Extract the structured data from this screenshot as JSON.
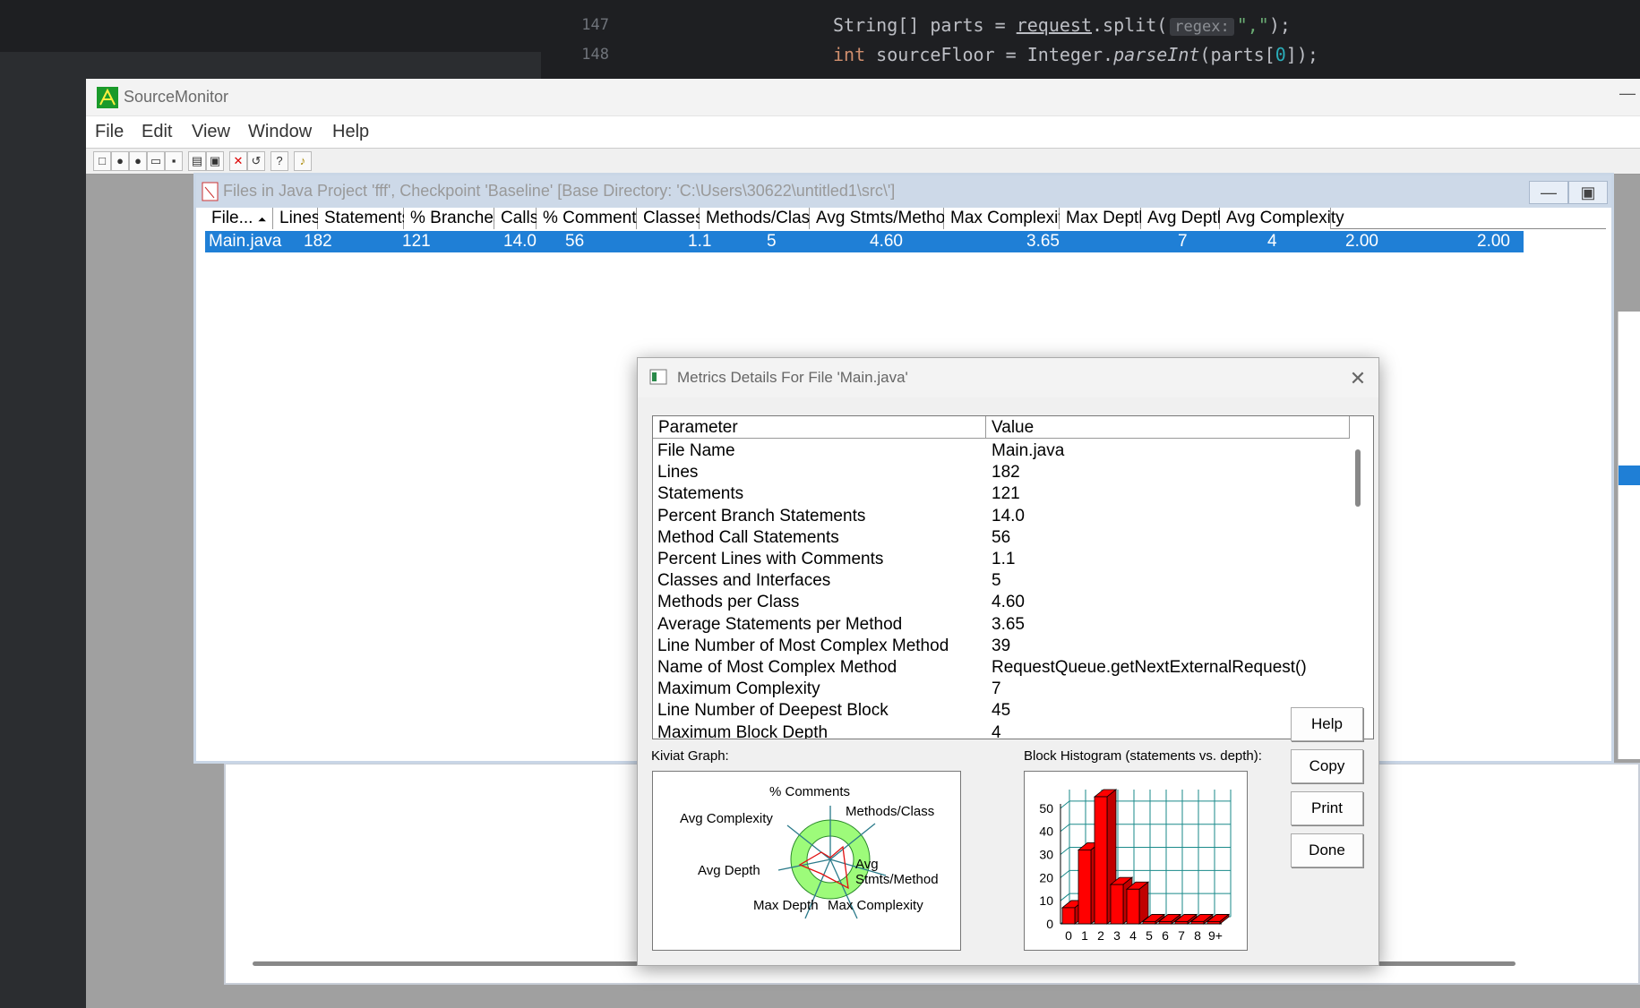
{
  "ide": {
    "line_numbers": [
      "147",
      "148"
    ],
    "line1": {
      "type": "String[] parts = ",
      "call": "request",
      "split": ".split(",
      "hint": "regex:",
      "str": "\",\"",
      "end": ");"
    },
    "line2": {
      "kw": "int",
      "rest": " sourceFloor = Integer.",
      "method": "parseInt",
      "args_open": "(parts[",
      "idx": "0",
      "args_close": "]);"
    }
  },
  "app": {
    "title": "SourceMonitor",
    "menu": [
      "File",
      "Edit",
      "View",
      "Window",
      "Help"
    ]
  },
  "files_window": {
    "title": "Files in Java Project 'fff', Checkpoint 'Baseline'  [Base Directory: 'C:\\Users\\30622\\untitled1\\src\\']",
    "columns": [
      "File...",
      "Lines",
      "Statements",
      "% Branches",
      "Calls",
      "% Comments",
      "Classes",
      "Methods/Class",
      "Avg Stmts/Method",
      "Max Complexity",
      "Max Depth",
      "Avg Depth",
      "Avg Complexity"
    ],
    "row": [
      "Main.java",
      "182",
      "121",
      "14.0",
      "56",
      "1.1",
      "5",
      "4.60",
      "3.65",
      "7",
      "4",
      "2.00",
      "2.00"
    ]
  },
  "dialog": {
    "title": "Metrics Details For File 'Main.java'",
    "header_param": "Parameter",
    "header_value": "Value",
    "rows": [
      {
        "p": "File Name",
        "v": "Main.java"
      },
      {
        "p": "Lines",
        "v": "182"
      },
      {
        "p": "Statements",
        "v": "121"
      },
      {
        "p": "Percent Branch Statements",
        "v": "14.0"
      },
      {
        "p": "Method Call Statements",
        "v": "56"
      },
      {
        "p": "Percent Lines with Comments",
        "v": "1.1"
      },
      {
        "p": "Classes and Interfaces",
        "v": "5"
      },
      {
        "p": "Methods per Class",
        "v": "4.60"
      },
      {
        "p": "Average Statements per Method",
        "v": "3.65"
      },
      {
        "p": "Line Number of Most Complex Method",
        "v": "39"
      },
      {
        "p": "Name of Most Complex Method",
        "v": "RequestQueue.getNextExternalRequest()"
      },
      {
        "p": "Maximum Complexity",
        "v": "7"
      },
      {
        "p": "Line Number of Deepest Block",
        "v": "45"
      },
      {
        "p": "Maximum Block Depth",
        "v": "4"
      }
    ],
    "kiviat_label": "Kiviat Graph:",
    "kiviat_axes": [
      "% Comments",
      "Methods/Class",
      "Avg Stmts/Method",
      "Max Complexity",
      "Max Depth",
      "Avg Depth",
      "Avg Complexity"
    ],
    "hist_label": "Block Histogram (statements vs. depth):",
    "buttons": [
      "Help",
      "Copy",
      "Print",
      "Done"
    ]
  },
  "chart_data": {
    "type": "bar",
    "categories": [
      "0",
      "1",
      "2",
      "3",
      "4",
      "5",
      "6",
      "7",
      "8",
      "9+"
    ],
    "values": [
      7,
      32,
      55,
      17,
      15,
      1,
      1,
      1,
      1,
      1
    ],
    "ylim": [
      0,
      55
    ],
    "yticks": [
      "0",
      "10",
      "20",
      "30",
      "40",
      "50"
    ],
    "color": "#ff0000"
  }
}
